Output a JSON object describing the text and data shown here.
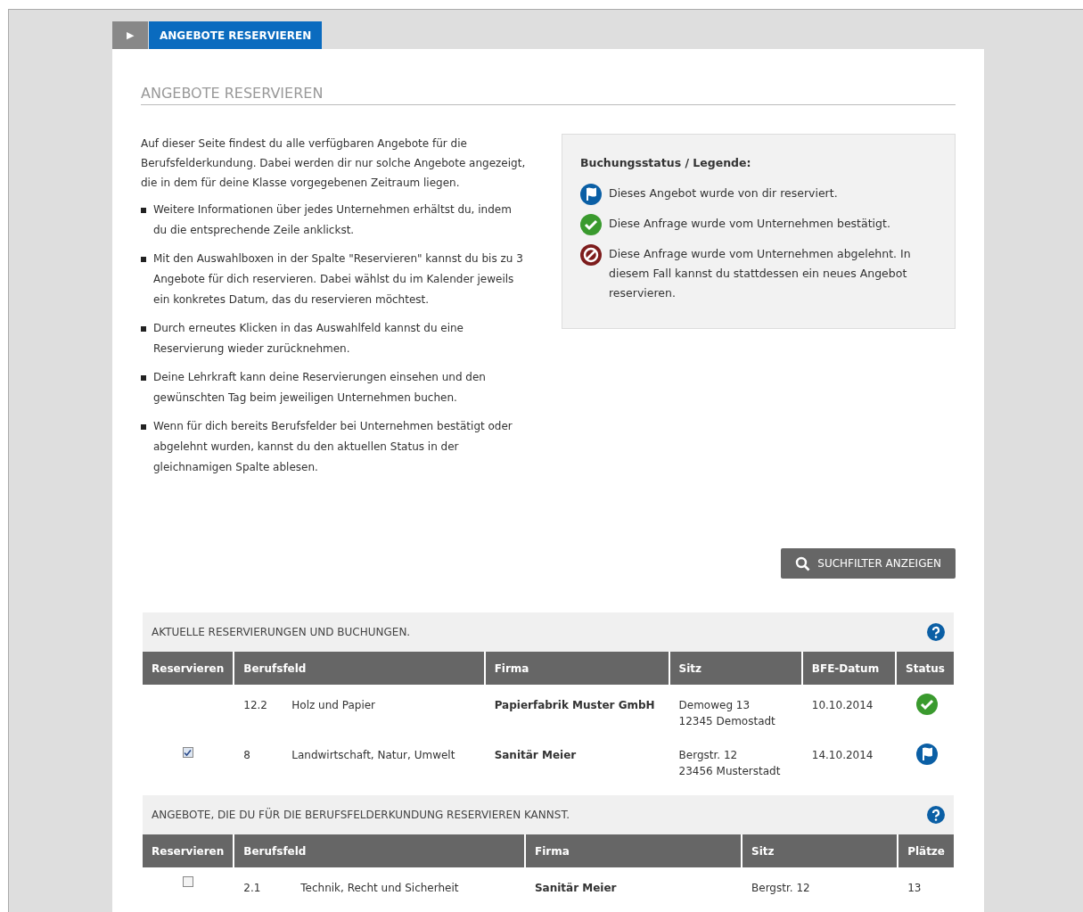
{
  "tab_bar": {
    "toggle_icon": "▶",
    "tab": {
      "label": "ANGEBOTE RESERVIEREN",
      "selected": true
    }
  },
  "page_title": "ANGEBOTE RESERVIEREN",
  "intro": "Auf dieser Seite findest du alle verfügbaren Angebote für die Berufsfelderkundung. Dabei werden dir nur solche Angebote angezeigt, die in dem für deine Klasse vorgegebenen Zeitraum liegen.",
  "bullets": [
    "Weitere Informationen über jedes Unternehmen erhältst du, indem du die entsprechende Zeile anklickst.",
    "Mit den Auswahlboxen in der Spalte \"Reservieren\" kannst du bis zu 3 Angebote für dich reservieren. Dabei wählst du im Kalender jeweils ein konkretes Datum, das du reservieren möchtest.",
    "Durch erneutes Klicken in das Auswahlfeld kannst du eine Reservierung wieder zurücknehmen.",
    "Deine Lehrkraft kann deine Reservierungen einsehen und den gewünschten Tag beim jeweiligen Unternehmen buchen.",
    "Wenn für dich bereits Berufsfelder bei Unternehmen bestätigt oder abgelehnt wurden, kannst du den aktuellen Status in der gleichnamigen Spalte ablesen."
  ],
  "legend": {
    "title": "Buchungsstatus / Legende:",
    "items": [
      {
        "kind": "reserved",
        "text": "Dieses Angebot wurde von dir reserviert."
      },
      {
        "kind": "confirmed",
        "text": "Diese Anfrage wurde vom Unternehmen bestätigt."
      },
      {
        "kind": "declined",
        "text": "Diese Anfrage wurde vom Unternehmen abgelehnt. In diesem Fall kannst du stattdessen ein neues Angebot reservieren."
      }
    ]
  },
  "filter_button": "SUCHFILTER ANZEIGEN",
  "bookings": {
    "title": "AKTUELLE RESERVIERUNGEN UND BUCHUNGEN.",
    "columns": [
      "Reservieren",
      "Berufsfeld",
      "Firma",
      "Sitz",
      "BFE-Datum",
      "Status"
    ],
    "rows": [
      {
        "code": "12.2",
        "field": "Holz und Papier",
        "company": "Papierfabrik Muster GmbH",
        "street": "Demoweg 13",
        "city": "12345 Demostadt",
        "date": "10.10.2014",
        "kind": "confirmed"
      },
      {
        "reserve": {
          "checked": true
        },
        "code": "8",
        "field": "Landwirtschaft, Natur, Umwelt",
        "company": "Sanitär Meier",
        "street": "Bergstr. 12",
        "city": "23456 Musterstadt",
        "date": "14.10.2014",
        "kind": "reserved"
      }
    ]
  },
  "offers": {
    "title": "ANGEBOTE, DIE DU FÜR DIE BERUFSFELDERKUNDUNG RESERVIEREN KANNST.",
    "columns": [
      "Reservieren",
      "Berufsfeld",
      "Firma",
      "Sitz",
      "Plätze"
    ],
    "rows": [
      {
        "checked": false,
        "code": "2.1",
        "field": "Technik, Recht und Sicherheit",
        "company": "Sanitär Meier",
        "street": "Bergstr. 12",
        "places": "13"
      }
    ]
  }
}
